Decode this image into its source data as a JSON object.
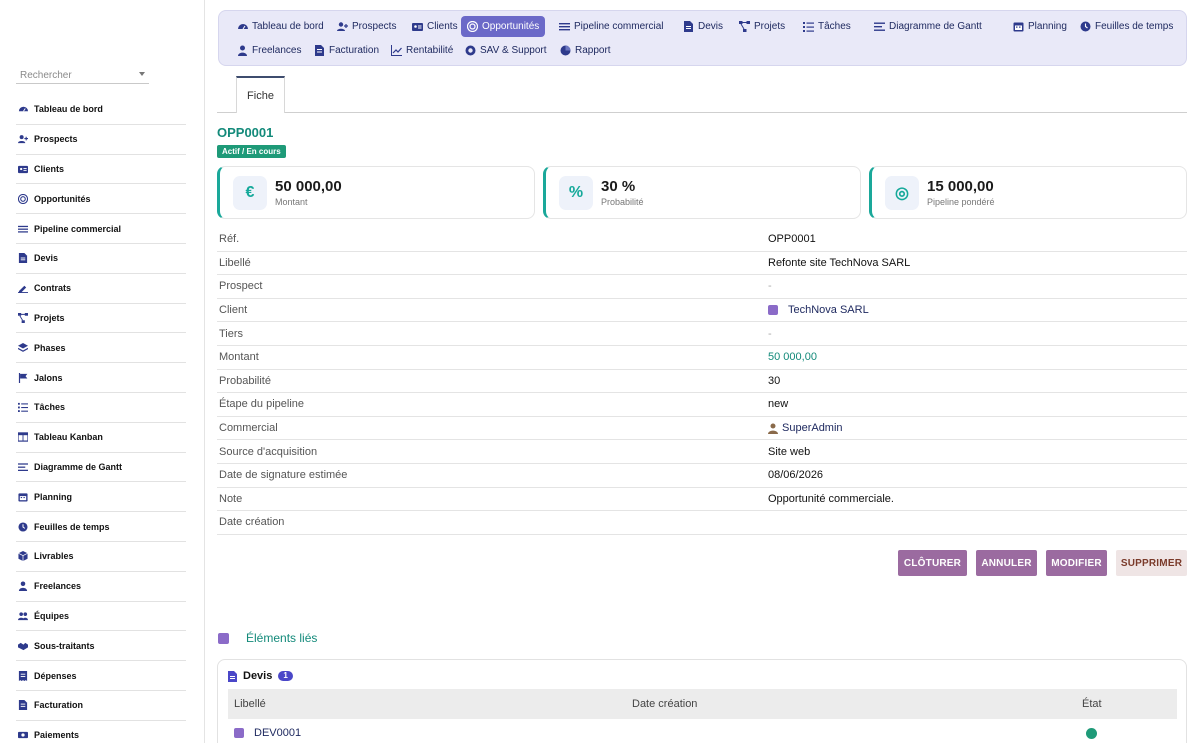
{
  "sidebar": {
    "search_placeholder": "Rechercher",
    "items": [
      {
        "label": "Tableau de bord",
        "icon": "gauge-icon"
      },
      {
        "label": "Prospects",
        "icon": "user-plus-icon"
      },
      {
        "label": "Clients",
        "icon": "address-card-icon"
      },
      {
        "label": "Opportunités",
        "icon": "target-icon"
      },
      {
        "label": "Pipeline commercial",
        "icon": "bars-icon"
      },
      {
        "label": "Devis",
        "icon": "file-icon"
      },
      {
        "label": "Contrats",
        "icon": "signature-icon"
      },
      {
        "label": "Projets",
        "icon": "project-diagram-icon"
      },
      {
        "label": "Phases",
        "icon": "layers-icon"
      },
      {
        "label": "Jalons",
        "icon": "flag-icon"
      },
      {
        "label": "Tâches",
        "icon": "tasks-icon"
      },
      {
        "label": "Tableau Kanban",
        "icon": "columns-icon"
      },
      {
        "label": "Diagramme de Gantt",
        "icon": "gantt-icon"
      },
      {
        "label": "Planning",
        "icon": "calendar-icon"
      },
      {
        "label": "Feuilles de temps",
        "icon": "clock-icon"
      },
      {
        "label": "Livrables",
        "icon": "box-icon"
      },
      {
        "label": "Freelances",
        "icon": "user-icon"
      },
      {
        "label": "Équipes",
        "icon": "users-icon"
      },
      {
        "label": "Sous-traitants",
        "icon": "handshake-icon"
      },
      {
        "label": "Dépenses",
        "icon": "receipt-icon"
      },
      {
        "label": "Facturation",
        "icon": "invoice-icon"
      },
      {
        "label": "Paiements",
        "icon": "money-icon"
      }
    ]
  },
  "topnav": {
    "row1": [
      {
        "label": "Tableau de bord",
        "icon": "gauge-icon",
        "active": false
      },
      {
        "label": "Prospects",
        "icon": "user-plus-icon",
        "active": false
      },
      {
        "label": "Clients",
        "icon": "address-card-icon",
        "active": false
      },
      {
        "label": "Opportunités",
        "icon": "target-icon",
        "active": true
      },
      {
        "label": "Pipeline commercial",
        "icon": "bars-icon",
        "active": false
      },
      {
        "label": "Devis",
        "icon": "file-icon",
        "active": false
      },
      {
        "label": "Projets",
        "icon": "project-diagram-icon",
        "active": false
      },
      {
        "label": "Tâches",
        "icon": "tasks-icon",
        "active": false
      },
      {
        "label": "Diagramme de Gantt",
        "icon": "gantt-icon",
        "active": false
      },
      {
        "label": "Planning",
        "icon": "calendar-icon",
        "active": false
      },
      {
        "label": "Feuilles de temps",
        "icon": "clock-icon",
        "active": false
      }
    ],
    "row2": [
      {
        "label": "Freelances",
        "icon": "user-icon",
        "active": false
      },
      {
        "label": "Facturation",
        "icon": "invoice-icon",
        "active": false
      },
      {
        "label": "Rentabilité",
        "icon": "chart-line-icon",
        "active": false
      },
      {
        "label": "SAV & Support",
        "icon": "lifebuoy-icon",
        "active": false
      },
      {
        "label": "Rapport",
        "icon": "pie-icon",
        "active": false
      }
    ]
  },
  "tabs": {
    "fiche": "Fiche"
  },
  "record": {
    "ref": "OPP0001",
    "status": "Actif / En cours"
  },
  "stats": [
    {
      "value": "50 000,00",
      "label": "Montant",
      "icon": "€"
    },
    {
      "value": "30 %",
      "label": "Probabilité",
      "icon": "%"
    },
    {
      "value": "15 000,00",
      "label": "Pipeline pondéré",
      "icon": "◎"
    }
  ],
  "details": [
    {
      "key": "Réf.",
      "value": "OPP0001"
    },
    {
      "key": "Libellé",
      "value": "Refonte site TechNova SARL"
    },
    {
      "key": "Prospect",
      "value": "-"
    },
    {
      "key": "Client",
      "value": "TechNova SARL"
    },
    {
      "key": "Tiers",
      "value": "-"
    },
    {
      "key": "Montant",
      "value": "50 000,00"
    },
    {
      "key": "Probabilité",
      "value": "30"
    },
    {
      "key": "Étape du pipeline",
      "value": "new"
    },
    {
      "key": "Commercial",
      "value": "SuperAdmin"
    },
    {
      "key": "Source d'acquisition",
      "value": "Site web"
    },
    {
      "key": "Date de signature estimée",
      "value": "08/06/2026"
    },
    {
      "key": "Note",
      "value": "Opportunité commerciale."
    },
    {
      "key": "Date création",
      "value": ""
    }
  ],
  "actions": {
    "close": "CLÔTURER",
    "cancel": "ANNULER",
    "edit": "MODIFIER",
    "delete": "SUPPRIMER"
  },
  "linked": {
    "title": "Éléments liés",
    "devis": {
      "label": "Devis",
      "count": "1",
      "columns": [
        "Libellé",
        "Date création",
        "État"
      ],
      "rows": [
        {
          "label": "DEV0001",
          "date": "",
          "status_color": "#1e9a78"
        }
      ]
    }
  },
  "colors": {
    "accent": "#6b69c8",
    "teal": "#138a7a",
    "button": "#9b6ba0"
  }
}
